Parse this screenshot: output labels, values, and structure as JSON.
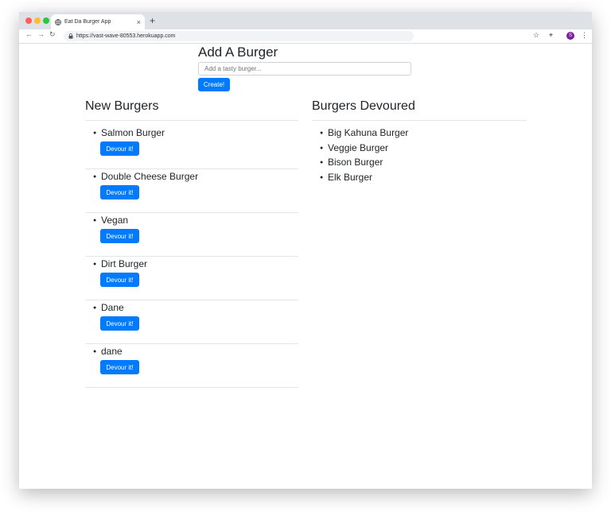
{
  "browser": {
    "tab_title": "Eat Da Burger App",
    "tab_close": "×",
    "new_tab": "+",
    "url": "https://vast-wave-80553.herokuapp.com",
    "profile_initial": "S",
    "icons": [
      "back-icon",
      "forward-icon",
      "reload-icon",
      "lock-icon",
      "star-icon",
      "cast-icon",
      "menu-icon",
      "globe-icon"
    ],
    "traffic_lights": [
      "#ff5f57",
      "#febc2e",
      "#28c840"
    ]
  },
  "form": {
    "title": "Add A Burger",
    "placeholder": "Add a tasty burger...",
    "value": "",
    "submit_label": "Create!"
  },
  "new_burgers": {
    "title": "New Burgers",
    "button_label": "Devour it!",
    "items": [
      "Salmon Burger",
      "Double Cheese Burger",
      "Vegan",
      "Dirt Burger",
      "Dane",
      "dane"
    ]
  },
  "devoured": {
    "title": "Burgers Devoured",
    "items": [
      "Big Kahuna Burger",
      "Veggie Burger",
      "Bison Burger",
      "Elk Burger"
    ]
  },
  "colors": {
    "primary": "#007bff",
    "text": "#212529",
    "tabbar": "#dee1e6"
  }
}
